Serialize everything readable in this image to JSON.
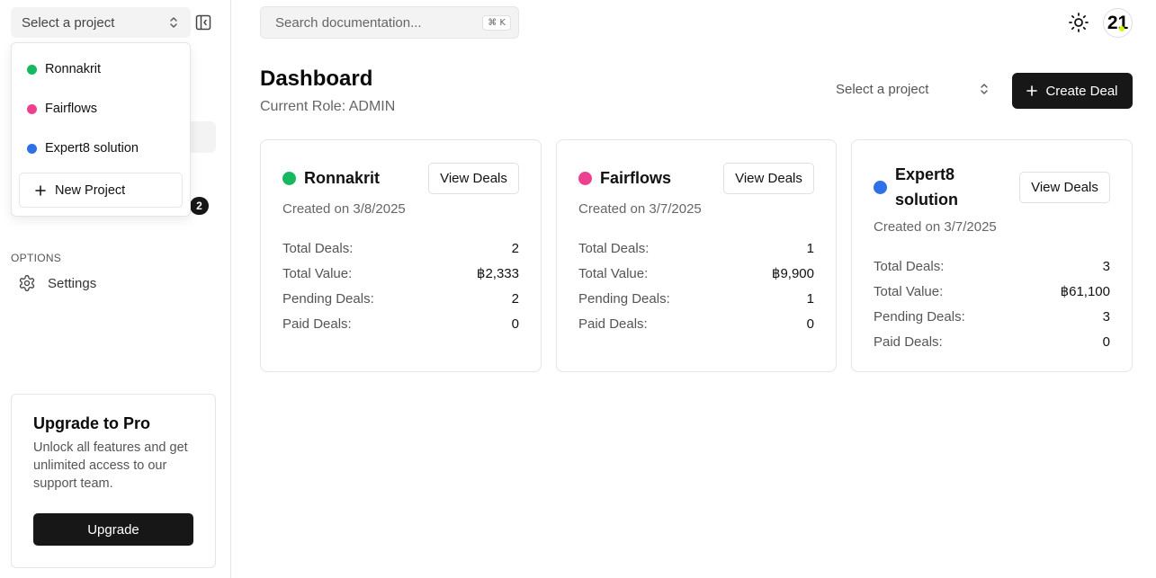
{
  "sidebar": {
    "project_select": {
      "placeholder": "Select a project"
    },
    "badge_count": "2",
    "options_label": "OPTIONS",
    "settings_label": "Settings",
    "upgrade": {
      "title": "Upgrade to Pro",
      "description": "Unlock all features and get unlimited access to our support team.",
      "button_label": "Upgrade"
    }
  },
  "dropdown": {
    "items": [
      {
        "label": "Ronnakrit",
        "color": "#16b960"
      },
      {
        "label": "Fairflows",
        "color": "#ec4190"
      },
      {
        "label": "Expert8 solution",
        "color": "#2f6fe8"
      }
    ],
    "new_project_label": "New Project"
  },
  "header": {
    "search_placeholder": "Search documentation...",
    "shortcut": "⌘ K",
    "avatar_text": "21"
  },
  "main": {
    "title": "Dashboard",
    "role_text": "Current Role: ADMIN",
    "project_select_placeholder": "Select a project",
    "create_deal_label": "Create Deal",
    "view_deals_label": "View Deals",
    "stat_labels": {
      "total_deals": "Total Deals:",
      "total_value": "Total Value:",
      "pending_deals": "Pending Deals:",
      "paid_deals": "Paid Deals:"
    },
    "projects": [
      {
        "name": "Ronnakrit",
        "color": "#16b960",
        "created": "Created on 3/8/2025",
        "total_deals": "2",
        "total_value": "฿2,333",
        "pending_deals": "2",
        "paid_deals": "0"
      },
      {
        "name": "Fairflows",
        "color": "#ec4190",
        "created": "Created on 3/7/2025",
        "total_deals": "1",
        "total_value": "฿9,900",
        "pending_deals": "1",
        "paid_deals": "0"
      },
      {
        "name": "Expert8 solution",
        "color": "#2f6fe8",
        "created": "Created on 3/7/2025",
        "total_deals": "3",
        "total_value": "฿61,100",
        "pending_deals": "3",
        "paid_deals": "0"
      }
    ]
  }
}
